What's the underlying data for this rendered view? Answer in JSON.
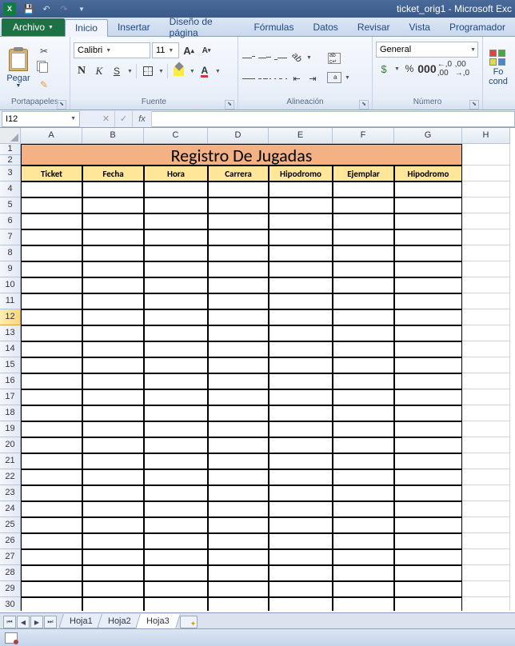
{
  "window": {
    "title": "ticket_orig1 - Microsoft Exc"
  },
  "tabs": {
    "file": "Archivo",
    "items": [
      "Inicio",
      "Insertar",
      "Diseño de página",
      "Fórmulas",
      "Datos",
      "Revisar",
      "Vista",
      "Programador"
    ],
    "active": "Inicio"
  },
  "ribbon": {
    "clipboard": {
      "paste": "Pegar",
      "label": "Portapapeles"
    },
    "font": {
      "name": "Calibri",
      "size": "11",
      "label": "Fuente"
    },
    "alignment": {
      "label": "Alineación"
    },
    "number": {
      "format": "General",
      "label": "Número"
    },
    "cond": {
      "label1": "Fo",
      "label2": "cond"
    }
  },
  "namebox": "I12",
  "columns": [
    "A",
    "B",
    "C",
    "D",
    "E",
    "F",
    "G",
    "H"
  ],
  "rows": [
    "1",
    "2",
    "3",
    "4",
    "5",
    "6",
    "7",
    "8",
    "9",
    "10",
    "11",
    "12",
    "13",
    "14",
    "15",
    "16",
    "17",
    "18",
    "19",
    "20",
    "21",
    "22",
    "23",
    "24",
    "25",
    "26",
    "27",
    "28",
    "29",
    "30"
  ],
  "sheet": {
    "title": "Registro De Jugadas",
    "headers": [
      "Ticket",
      "Fecha",
      "Hora",
      "Carrera",
      "Hipodromo",
      "Ejemplar",
      "Hipodromo"
    ]
  },
  "sheets": {
    "list": [
      "Hoja1",
      "Hoja2",
      "Hoja3"
    ],
    "active": "Hoja3"
  }
}
